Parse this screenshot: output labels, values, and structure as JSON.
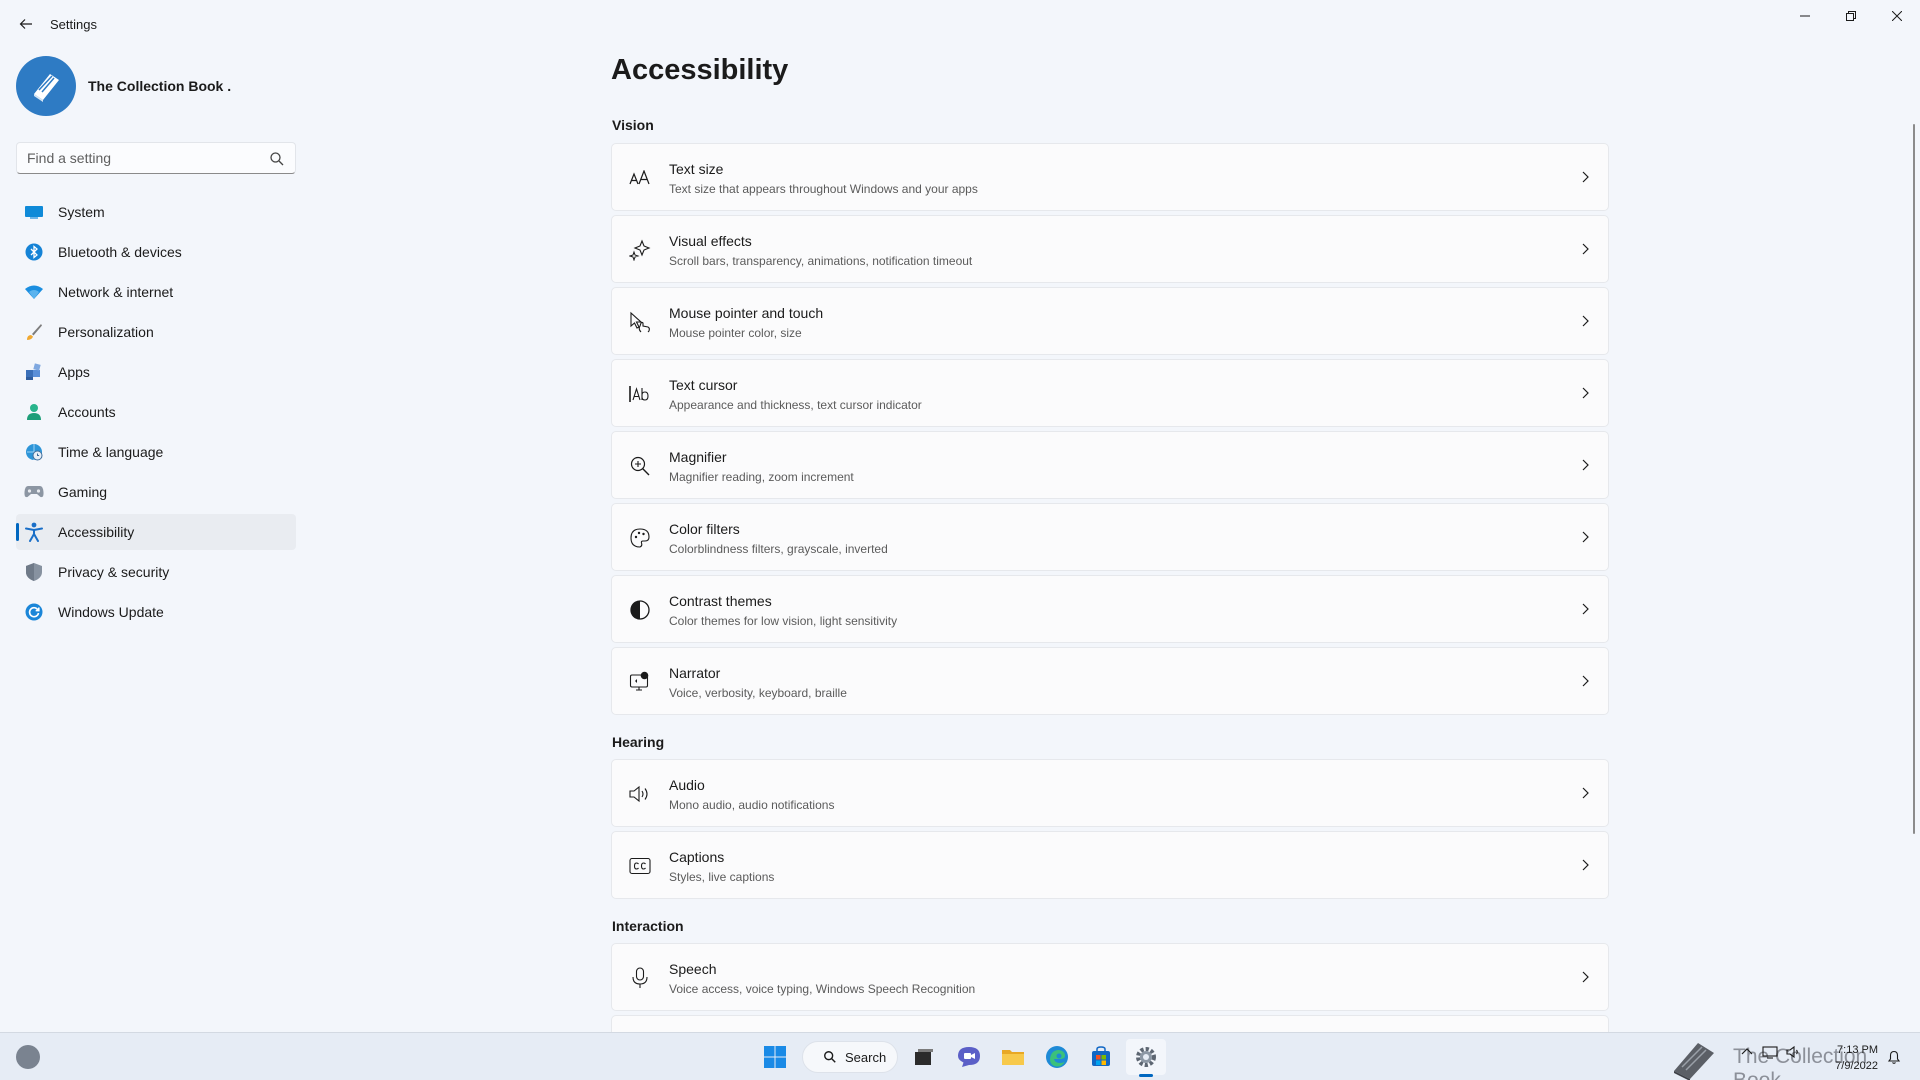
{
  "window": {
    "title": "Settings"
  },
  "profile": {
    "name": "The Collection Book ."
  },
  "search": {
    "placeholder": "Find a setting"
  },
  "nav": {
    "items": [
      {
        "label": "System",
        "icon": "monitor-icon"
      },
      {
        "label": "Bluetooth & devices",
        "icon": "bluetooth-icon"
      },
      {
        "label": "Network & internet",
        "icon": "wifi-icon"
      },
      {
        "label": "Personalization",
        "icon": "brush-icon"
      },
      {
        "label": "Apps",
        "icon": "apps-icon"
      },
      {
        "label": "Accounts",
        "icon": "person-icon"
      },
      {
        "label": "Time & language",
        "icon": "globe-clock-icon"
      },
      {
        "label": "Gaming",
        "icon": "gamepad-icon"
      },
      {
        "label": "Accessibility",
        "icon": "accessibility-icon",
        "active": true
      },
      {
        "label": "Privacy & security",
        "icon": "shield-icon"
      },
      {
        "label": "Windows Update",
        "icon": "update-icon"
      }
    ]
  },
  "main": {
    "title": "Accessibility",
    "sections": [
      {
        "title": "Vision",
        "cards": [
          {
            "title": "Text size",
            "subtitle": "Text size that appears throughout Windows and your apps",
            "icon": "text-size-icon"
          },
          {
            "title": "Visual effects",
            "subtitle": "Scroll bars, transparency, animations, notification timeout",
            "icon": "sparkle-icon"
          },
          {
            "title": "Mouse pointer and touch",
            "subtitle": "Mouse pointer color, size",
            "icon": "pointer-touch-icon"
          },
          {
            "title": "Text cursor",
            "subtitle": "Appearance and thickness, text cursor indicator",
            "icon": "text-cursor-icon"
          },
          {
            "title": "Magnifier",
            "subtitle": "Magnifier reading, zoom increment",
            "icon": "magnifier-icon"
          },
          {
            "title": "Color filters",
            "subtitle": "Colorblindness filters, grayscale, inverted",
            "icon": "palette-icon"
          },
          {
            "title": "Contrast themes",
            "subtitle": "Color themes for low vision, light sensitivity",
            "icon": "contrast-icon"
          },
          {
            "title": "Narrator",
            "subtitle": "Voice, verbosity, keyboard, braille",
            "icon": "narrator-icon"
          }
        ]
      },
      {
        "title": "Hearing",
        "cards": [
          {
            "title": "Audio",
            "subtitle": "Mono audio, audio notifications",
            "icon": "speaker-icon"
          },
          {
            "title": "Captions",
            "subtitle": "Styles, live captions",
            "icon": "captions-icon"
          }
        ]
      },
      {
        "title": "Interaction",
        "cards": [
          {
            "title": "Speech",
            "subtitle": "Voice access, voice typing, Windows Speech Recognition",
            "icon": "microphone-icon"
          }
        ]
      }
    ]
  },
  "taskbar": {
    "search_label": "Search",
    "watermark": "The Collection Book",
    "time": "7:13 PM",
    "date": "7/9/2022"
  },
  "colors": {
    "accent": "#0067c0",
    "background": "#f3f6fb",
    "card": "#fbfbfc"
  }
}
